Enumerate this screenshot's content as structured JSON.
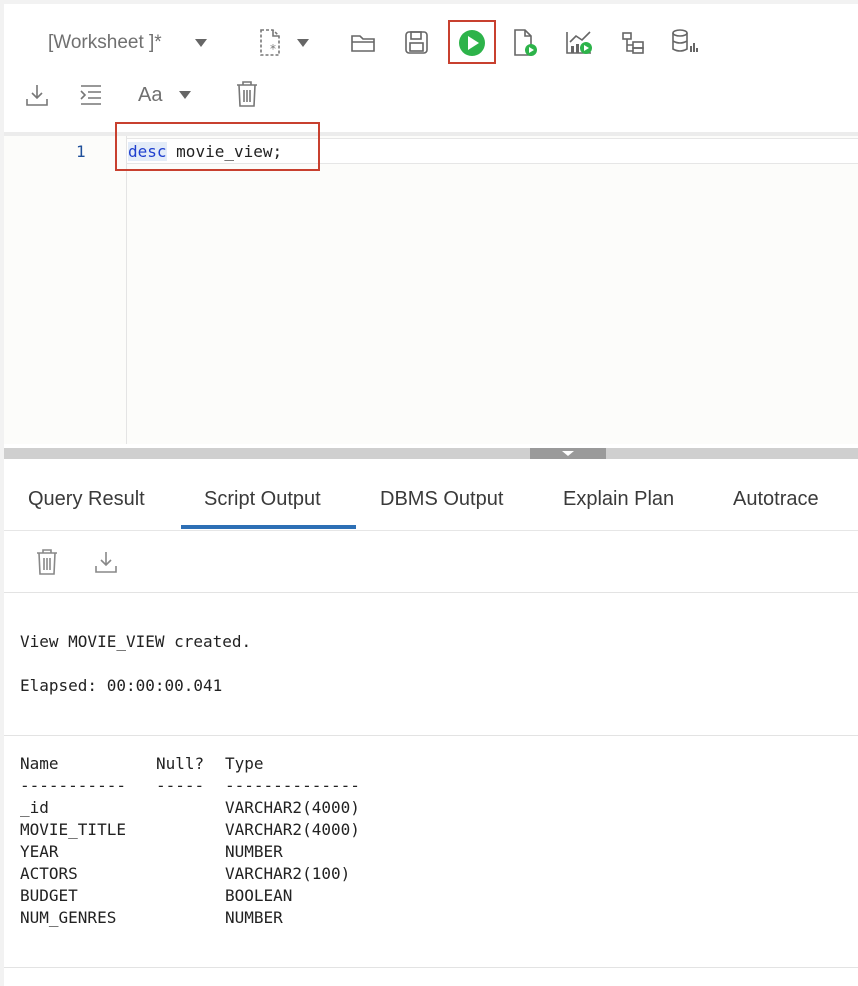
{
  "toolbar": {
    "worksheet_label": "[Worksheet ]*",
    "font_label": "Aa",
    "run_accent": "#2db34a",
    "highlight_color": "#c8402f"
  },
  "editor": {
    "line_number": "1",
    "keyword": "desc",
    "object_name": "movie_view;"
  },
  "tabs": [
    {
      "label": "Query Result"
    },
    {
      "label": "Script Output",
      "active": true
    },
    {
      "label": "DBMS Output"
    },
    {
      "label": "Explain Plan"
    },
    {
      "label": "Autotrace"
    }
  ],
  "output": {
    "created_message": "View MOVIE_VIEW created.",
    "elapsed": "Elapsed: 00:00:00.041",
    "describe": {
      "headers": [
        "Name",
        "Null?",
        "Type"
      ],
      "underline": [
        "-----------",
        "-----",
        "--------------"
      ],
      "rows": [
        {
          "name": "_id",
          "null": "",
          "type": "VARCHAR2(4000)"
        },
        {
          "name": "MOVIE_TITLE",
          "null": "",
          "type": "VARCHAR2(4000)"
        },
        {
          "name": "YEAR",
          "null": "",
          "type": "NUMBER"
        },
        {
          "name": "ACTORS",
          "null": "",
          "type": "VARCHAR2(100)"
        },
        {
          "name": "BUDGET",
          "null": "",
          "type": "BOOLEAN"
        },
        {
          "name": "NUM_GENRES",
          "null": "",
          "type": "NUMBER"
        }
      ]
    }
  },
  "icons": [
    "chevron-down-icon",
    "new-file-icon",
    "open-folder-icon",
    "save-icon",
    "run-statement-icon",
    "run-script-icon",
    "autotrace-chart-icon",
    "explain-plan-icon",
    "sql-tuning-icon",
    "download-icon",
    "format-indent-icon",
    "trash-icon"
  ]
}
